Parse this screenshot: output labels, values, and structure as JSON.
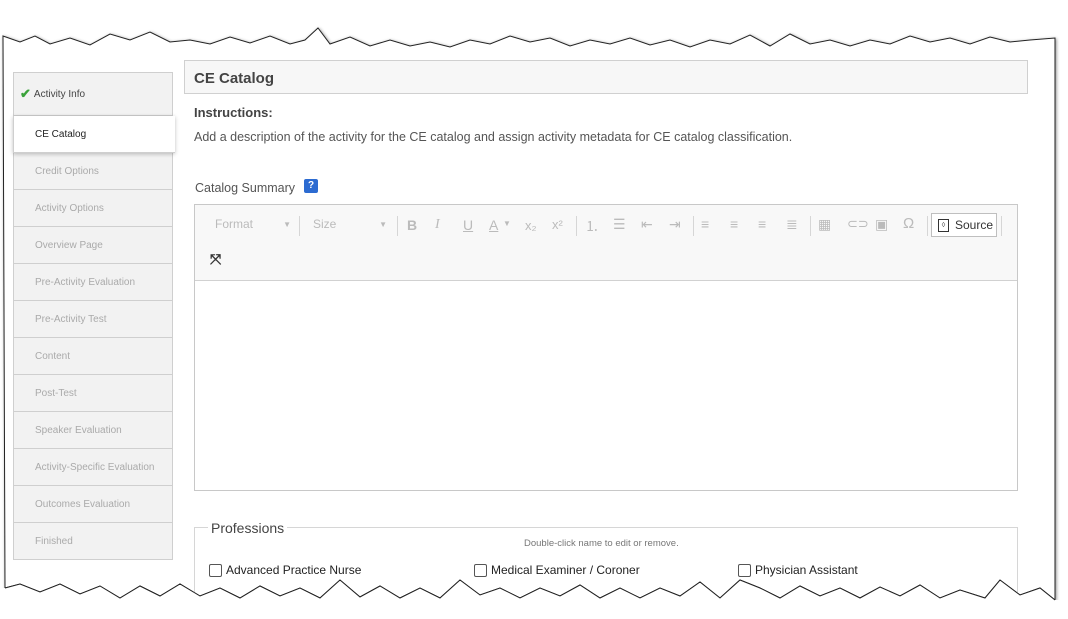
{
  "sidebar": {
    "items": [
      {
        "label": "Activity Info"
      },
      {
        "label": "CE Catalog"
      },
      {
        "label": "Credit Options"
      },
      {
        "label": "Activity Options"
      },
      {
        "label": "Overview Page"
      },
      {
        "label": "Pre-Activity Evaluation"
      },
      {
        "label": "Pre-Activity Test"
      },
      {
        "label": "Content"
      },
      {
        "label": "Post-Test"
      },
      {
        "label": "Speaker Evaluation"
      },
      {
        "label": "Activity-Specific Evaluation"
      },
      {
        "label": "Outcomes Evaluation"
      },
      {
        "label": "Finished"
      }
    ]
  },
  "main": {
    "title": "CE Catalog",
    "instructions_title": "Instructions:",
    "instructions_text": "Add a description of the activity for the CE catalog and assign activity metadata for CE catalog classification.",
    "summary_label": "Catalog Summary",
    "help_label": "?"
  },
  "editor": {
    "format": "Format",
    "size": "Size",
    "source": "Source"
  },
  "professions": {
    "legend": "Professions",
    "hint": "Double-click name to edit or remove.",
    "items": [
      {
        "label": "Advanced Practice Nurse"
      },
      {
        "label": "Medical Examiner / Coroner"
      },
      {
        "label": "Physician Assistant"
      }
    ]
  }
}
